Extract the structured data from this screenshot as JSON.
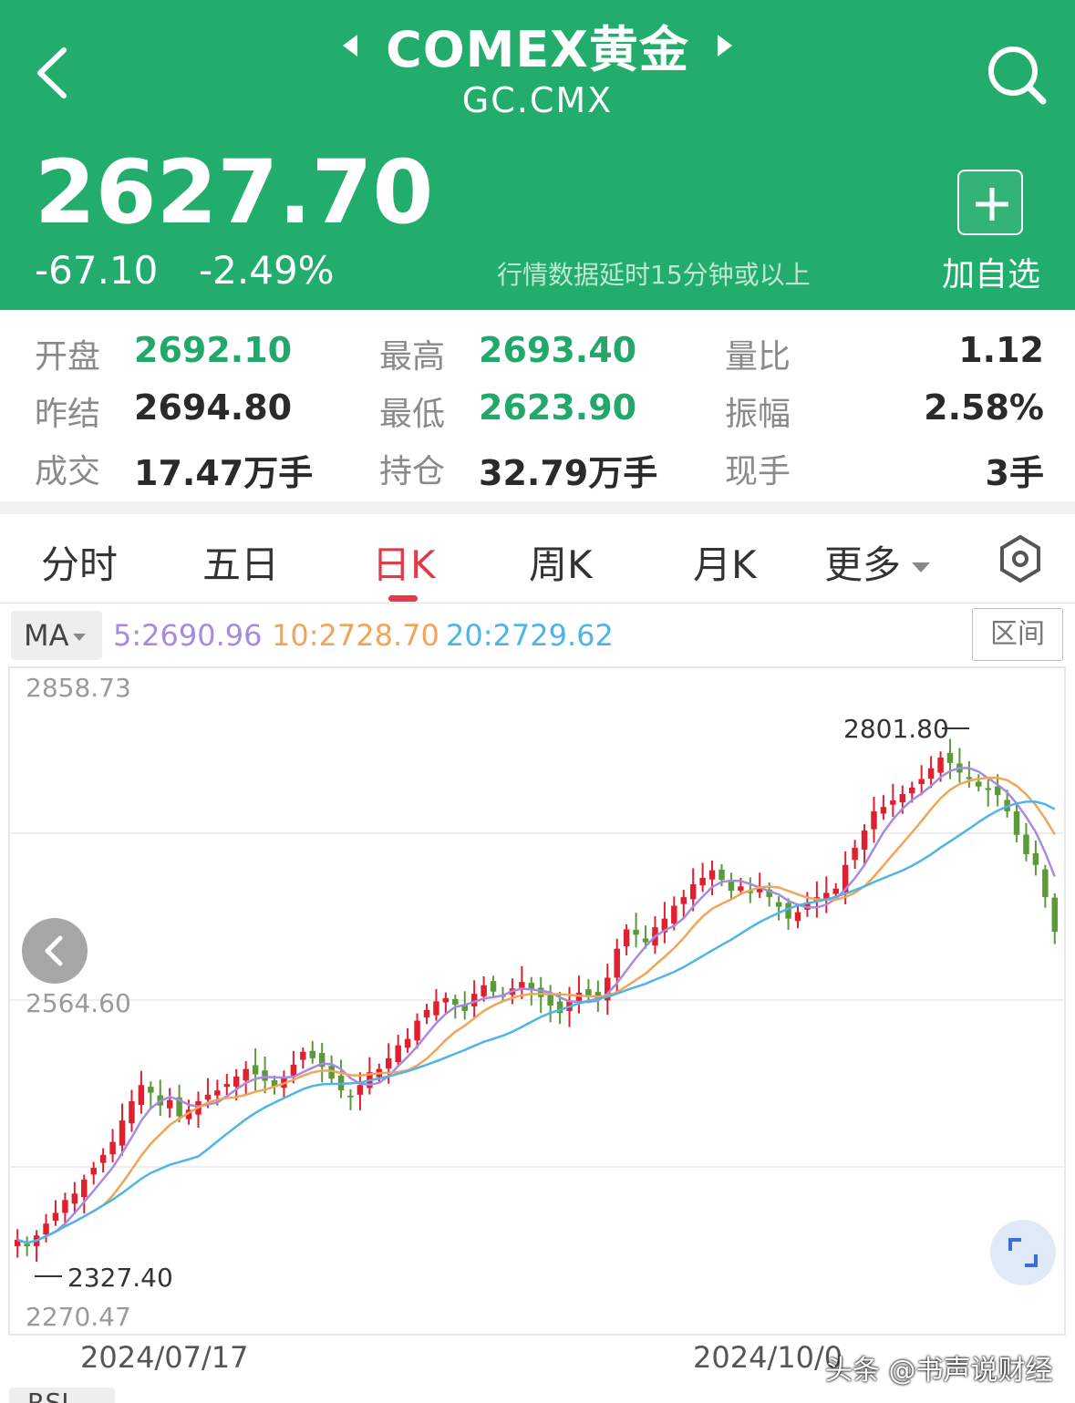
{
  "header": {
    "title": "COMEX黄金",
    "symbol": "GC.CMX",
    "price": "2627.70",
    "change": "-67.10",
    "change_pct": "-2.49%",
    "delay_note": "行情数据延时15分钟或以上",
    "add_label": "加自选",
    "bg_color": "#23ad6c"
  },
  "stats": {
    "open_label": "开盘",
    "open": "2692.10",
    "high_label": "最高",
    "high": "2693.40",
    "vol_ratio_label": "量比",
    "vol_ratio": "1.12",
    "prev_settle_label": "昨结",
    "prev_settle": "2694.80",
    "low_label": "最低",
    "low": "2623.90",
    "amplitude_label": "振幅",
    "amplitude": "2.58%",
    "volume_label": "成交",
    "volume": "17.47万手",
    "open_interest_label": "持仓",
    "open_interest": "32.79万手",
    "current_hand_label": "现手",
    "current_hand": "3手"
  },
  "tabs": {
    "items": [
      "分时",
      "五日",
      "日K",
      "周K",
      "月K",
      "更多"
    ],
    "active": "日K"
  },
  "ma": {
    "label": "MA",
    "ma5": "5:2690.96",
    "ma10": "10:2728.70",
    "ma20": "20:2729.62",
    "range_label": "区间",
    "colors": {
      "ma5": "#a78be0",
      "ma10": "#f2a55a",
      "ma20": "#4fb4e6"
    }
  },
  "chart_data": {
    "type": "candlestick",
    "y_ticks": [
      "2858.73",
      "2564.60",
      "2270.47"
    ],
    "ylim": [
      2270.47,
      2858.73
    ],
    "max_marker": "2801.80",
    "min_marker": "2327.40",
    "x_labels": [
      "2024/07/17",
      "2024/10/0"
    ],
    "up_color": "#e0202e",
    "down_color": "#5b9a3a",
    "closes": [
      2341,
      2335,
      2345,
      2356,
      2366,
      2378,
      2384,
      2397,
      2408,
      2420,
      2432,
      2452,
      2470,
      2485,
      2478,
      2466,
      2471,
      2456,
      2462,
      2470,
      2476,
      2480,
      2486,
      2493,
      2500,
      2495,
      2489,
      2484,
      2492,
      2504,
      2516,
      2510,
      2502,
      2491,
      2480,
      2474,
      2485,
      2497,
      2500,
      2510,
      2522,
      2528,
      2545,
      2555,
      2563,
      2566,
      2560,
      2554,
      2570,
      2578,
      2572,
      2568,
      2575,
      2581,
      2574,
      2567,
      2559,
      2552,
      2563,
      2571,
      2567,
      2565,
      2585,
      2612,
      2630,
      2625,
      2618,
      2632,
      2640,
      2652,
      2660,
      2672,
      2678,
      2685,
      2676,
      2666,
      2670,
      2664,
      2668,
      2660,
      2651,
      2640,
      2646,
      2655,
      2660,
      2664,
      2668,
      2690,
      2706,
      2722,
      2740,
      2744,
      2750,
      2756,
      2762,
      2770,
      2780,
      2790,
      2785,
      2776,
      2770,
      2763,
      2760,
      2755,
      2740,
      2718,
      2700,
      2690,
      2660,
      2627.7
    ]
  }
}
